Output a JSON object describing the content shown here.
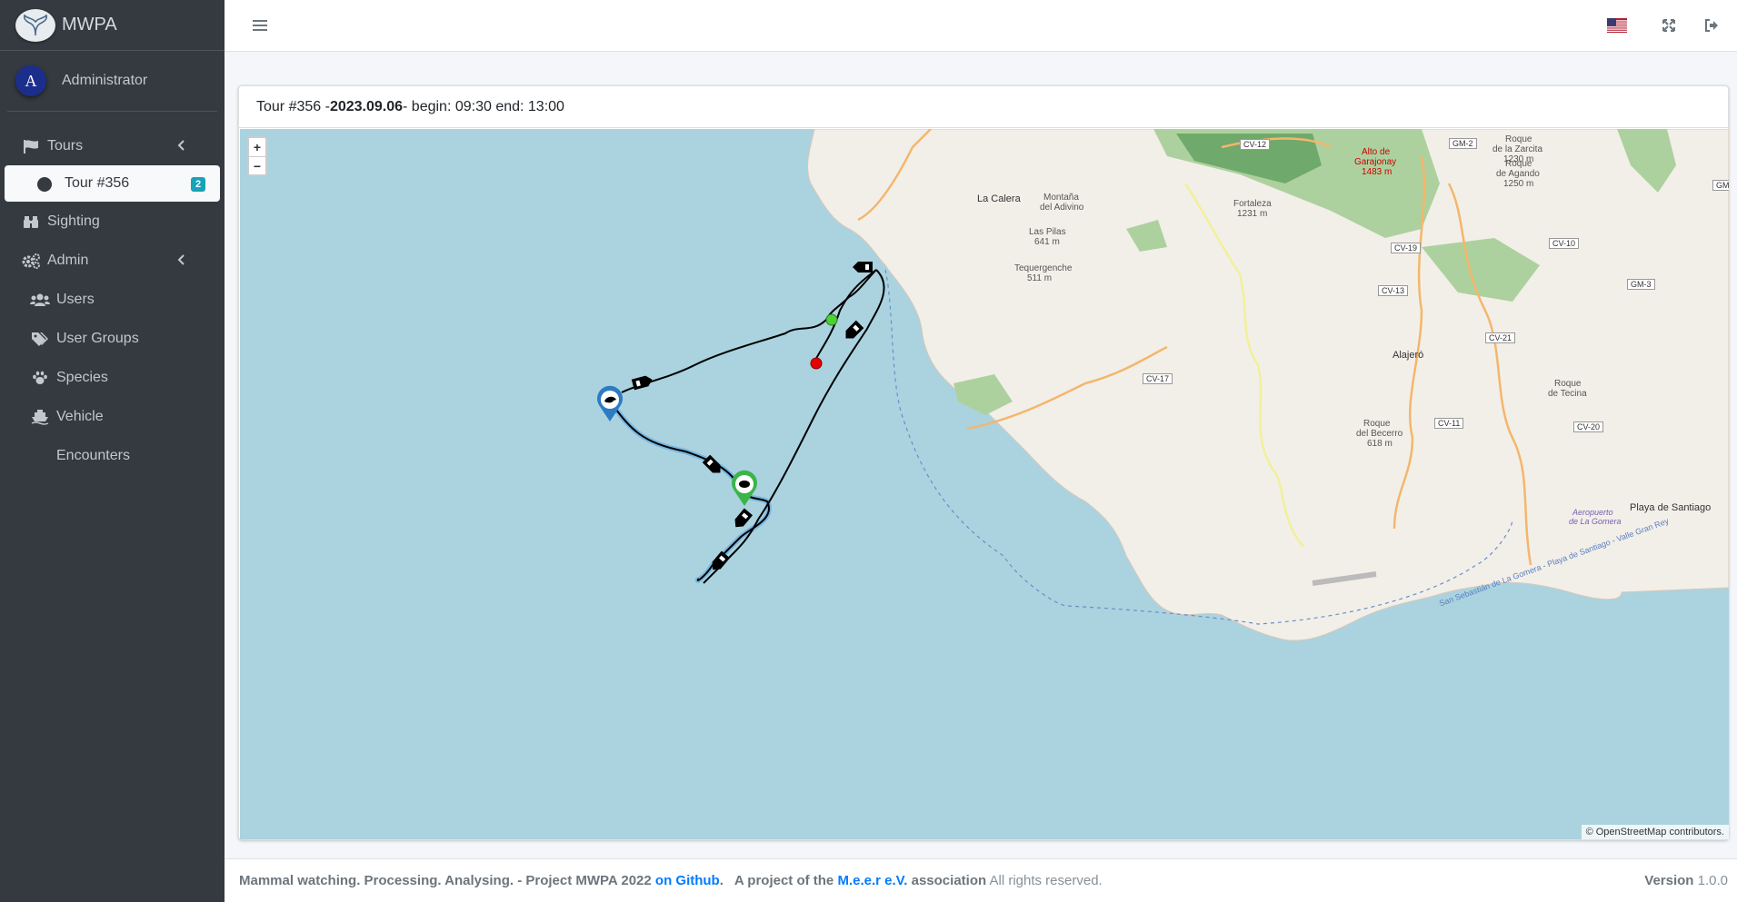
{
  "brand": {
    "name": "MWPA",
    "logo_icon": "whale-tail-icon"
  },
  "user": {
    "initial": "A",
    "name": "Administrator"
  },
  "sidebar": {
    "items": [
      {
        "label": "Tours",
        "icon": "flag-icon"
      },
      {
        "label": "Tour #356",
        "icon": "circle-icon",
        "badge": "2"
      },
      {
        "label": "Sighting",
        "icon": "binoculars-icon"
      },
      {
        "label": "Admin",
        "icon": "cogs-icon"
      },
      {
        "label": "Users",
        "icon": "users-icon"
      },
      {
        "label": "User Groups",
        "icon": "tags-icon"
      },
      {
        "label": "Species",
        "icon": "paw-icon"
      },
      {
        "label": "Vehicle",
        "icon": "ship-icon"
      },
      {
        "label": "Encounters"
      }
    ]
  },
  "topbar": {
    "menu_icon": "hamburger-icon",
    "flag_icon": "us-flag-icon",
    "fullscreen_icon": "expand-icon",
    "logout_icon": "sign-out-icon"
  },
  "card": {
    "title_prefix": "Tour #356 - ",
    "date": "2023.09.06",
    "title_suffix": " - begin: 09:30 end: 13:00"
  },
  "map": {
    "zoom_in": "+",
    "zoom_out": "−",
    "attribution_prefix": "© ",
    "attribution_link": "OpenStreetMap",
    "attribution_suffix": " contributors.",
    "labels": {
      "la_calera": "La Calera",
      "montana": "Montaña",
      "del_adivino": "del Adivino",
      "las_pilas": "Las Pilas",
      "las_pilas_h": "641 m",
      "tequergenche": "Tequergenche",
      "tequergenche_h": "511 m",
      "fortaleza": "Fortaleza",
      "fortaleza_h": "1231 m",
      "alto1": "Alto de",
      "alto2": "Garajonay",
      "alto3": "1483 m",
      "roque_zarcita1": "Roque",
      "roque_zarcita2": "de la Zarcita",
      "roque_zarcita3": "1230 m",
      "roque_agando1": "Roque",
      "roque_agando2": "de Agando",
      "roque_agando3": "1250 m",
      "alajero": "Alajeró",
      "roque_becerro1": "Roque",
      "roque_becerro2": "del Becerro",
      "roque_becerro3": "618 m",
      "roque_tecina1": "Roque",
      "roque_tecina2": "de Tecina",
      "playa": "Playa de Santiago",
      "aeropuerto1": "Aeropuerto",
      "aeropuerto2": "de La Gomera",
      "ferry": "San Sebastián de La Gomera - Playa de Santiago - Valle Gran Rey",
      "road_cv12": "CV-12",
      "road_gm2": "GM-2",
      "road_gm": "GM",
      "road_cv19": "CV-19",
      "road_cv10": "CV-10",
      "road_cv13": "CV-13",
      "road_gm3": "GM-3",
      "road_cv21": "CV-21",
      "road_cv17": "CV-17",
      "road_cv11": "CV-11",
      "road_cv20": "CV-20"
    }
  },
  "footer": {
    "text1": "Mammal watching. Processing. Analysing. - Project MWPA 2022 ",
    "link1": "on Github",
    "text2": ".   A project of the ",
    "link2": "M.e.e.r e.V.",
    "text3": " association",
    "text4": " All rights reserved.",
    "version_label": "Version",
    "version": " 1.0.0"
  }
}
